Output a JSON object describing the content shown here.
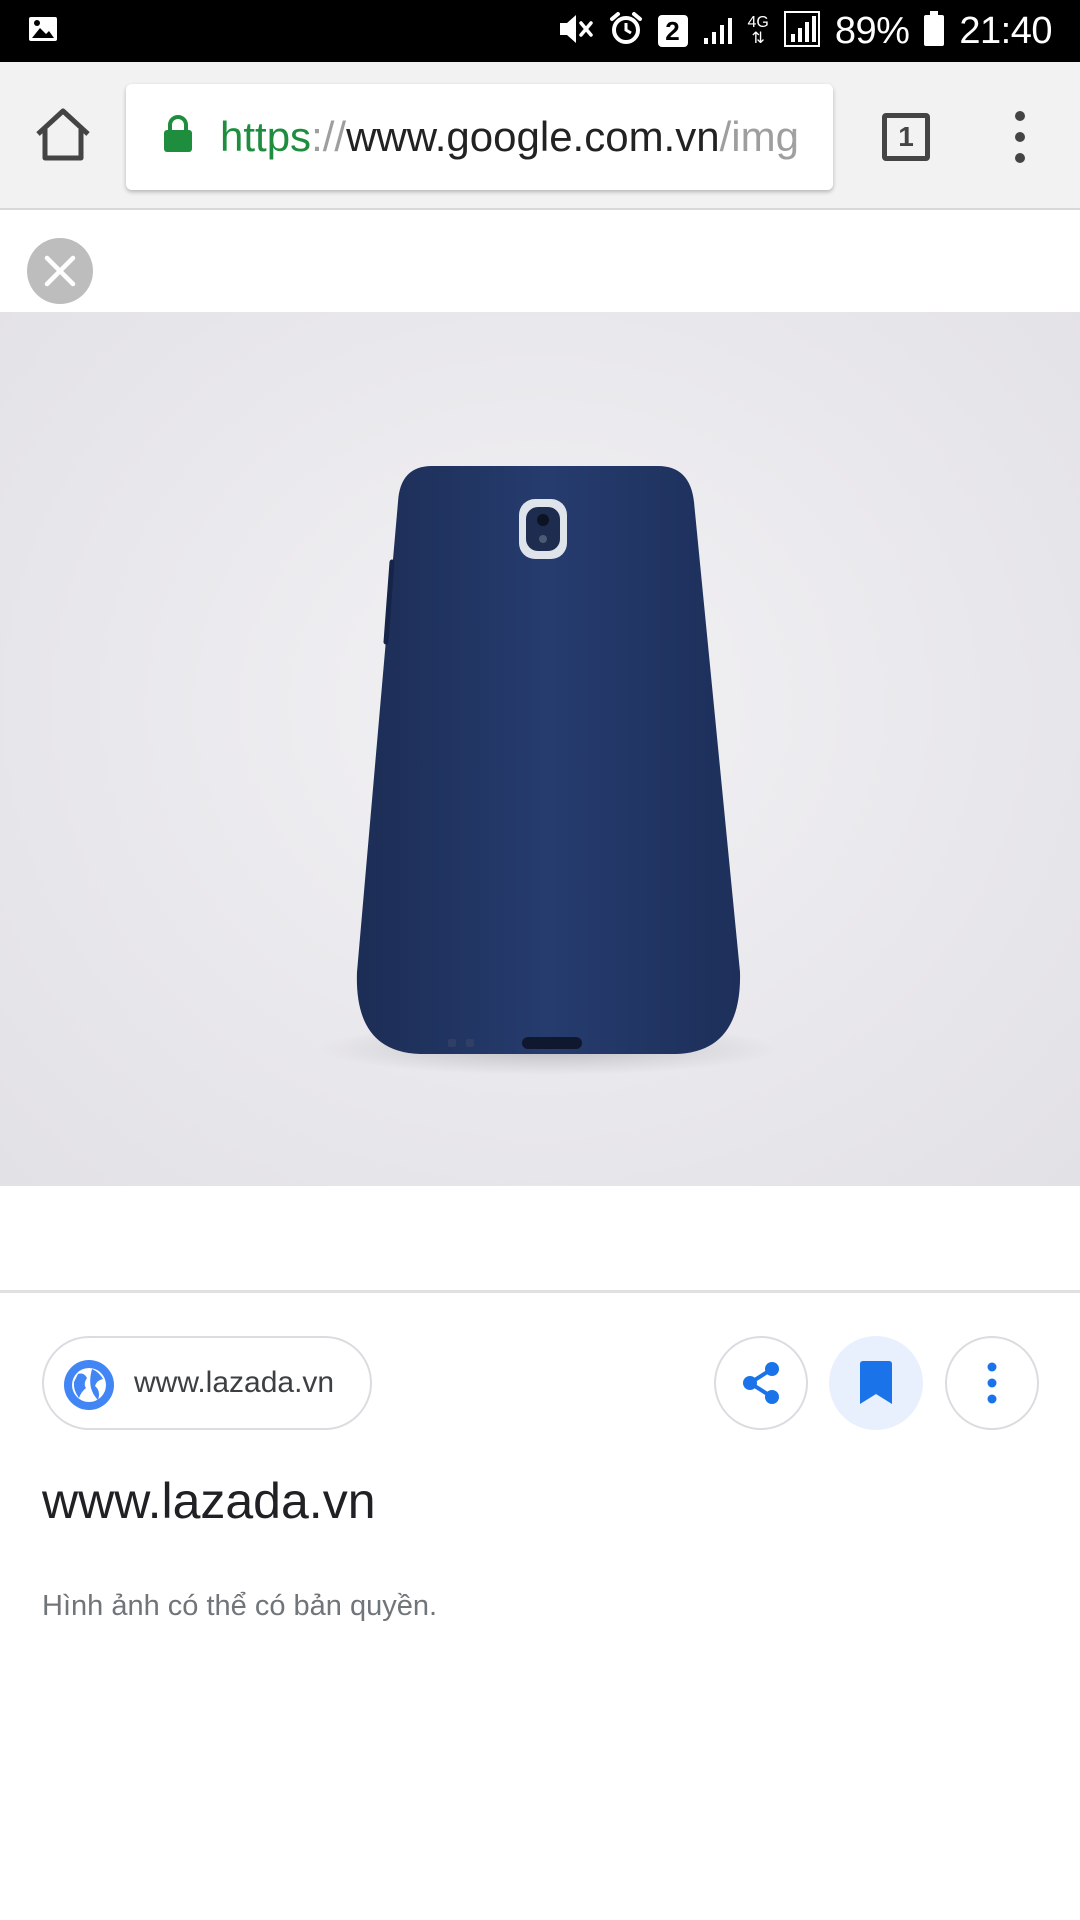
{
  "status_bar": {
    "network": "4G",
    "sim": "2",
    "battery": "89%",
    "time": "21:40"
  },
  "browser": {
    "url_scheme": "https",
    "url_separator": "://",
    "url_host": "www.google.com.vn",
    "url_path": "/img",
    "tab_count": "1"
  },
  "image": {
    "subject": "blue-phone-case"
  },
  "info": {
    "source_chip_label": "www.lazada.vn",
    "title": "www.lazada.vn",
    "copyright_note": "Hình ảnh có thể có bản quyền."
  },
  "colors": {
    "accent": "#1a73e8",
    "secure": "#1e8e3e",
    "phone_case": "#24396a"
  }
}
